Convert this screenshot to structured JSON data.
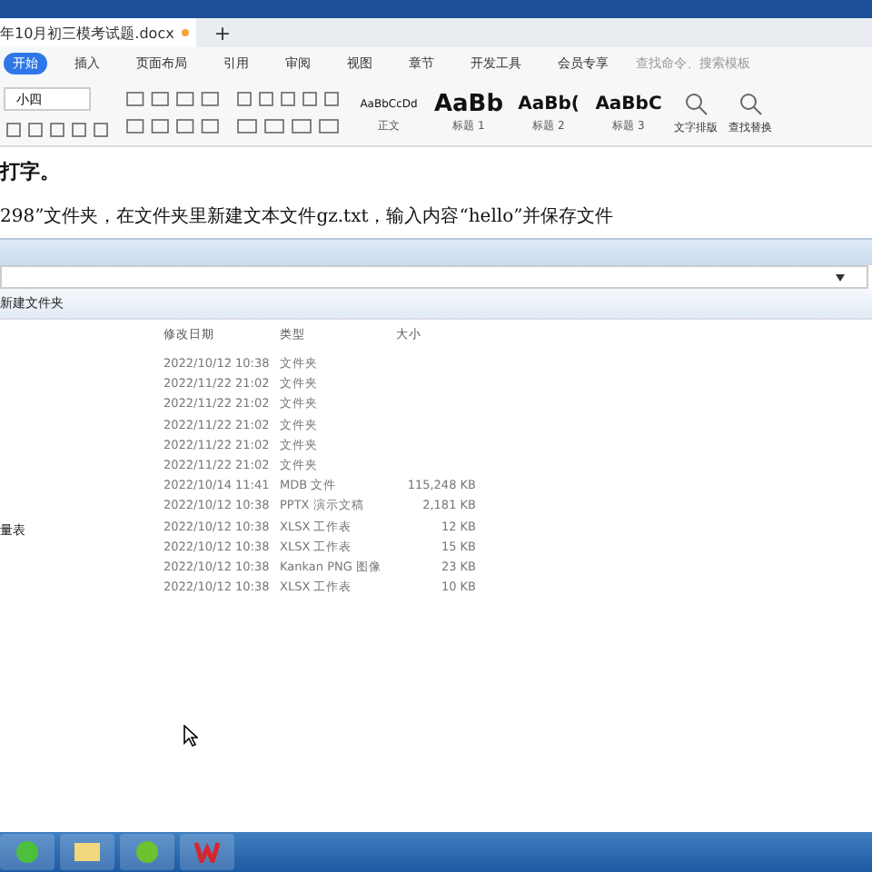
{
  "doc_tab": {
    "title": "年10月初三模考试题.docx",
    "add": "+"
  },
  "menu": {
    "items": [
      {
        "label": "开始",
        "selected": true
      },
      {
        "label": "插入",
        "selected": false
      },
      {
        "label": "页面布局",
        "selected": false
      },
      {
        "label": "引用",
        "selected": false
      },
      {
        "label": "审阅",
        "selected": false
      },
      {
        "label": "视图",
        "selected": false
      },
      {
        "label": "章节",
        "selected": false
      },
      {
        "label": "开发工具",
        "selected": false
      },
      {
        "label": "会员专享",
        "selected": false
      }
    ],
    "search_placeholder": "查找命令、搜索模板"
  },
  "toolbar": {
    "font_size": "小四",
    "styles": [
      {
        "sample": "AaBbCcDd",
        "name": "正文",
        "kind": "small"
      },
      {
        "sample": "AaBb",
        "name": "标题 1",
        "kind": "big"
      },
      {
        "sample": "AaBb(",
        "name": "标题 2",
        "kind": "mid"
      },
      {
        "sample": "AaBbC",
        "name": "标题 3",
        "kind": "mid"
      }
    ],
    "big_buttons": [
      "文字排版",
      "查找替换"
    ]
  },
  "document": {
    "lines": [
      "打字。",
      "298”文件夹，在文件夹里新建文本文件gz.txt，输入内容“hello”并保存文件"
    ]
  },
  "explorer": {
    "new_folder": "新建文件夹",
    "nav_item": "量表",
    "columns": [
      "修改日期",
      "类型",
      "大小"
    ],
    "rows": [
      [
        "2022/10/12 10:38",
        "文件夹",
        ""
      ],
      [
        "2022/11/22 21:02",
        "文件夹",
        ""
      ],
      [
        "2022/11/22 21:02",
        "文件夹",
        ""
      ],
      [
        "2022/11/22 21:02",
        "文件夹",
        ""
      ],
      [
        "2022/11/22 21:02",
        "文件夹",
        ""
      ],
      [
        "2022/11/22 21:02",
        "文件夹",
        ""
      ],
      [
        "2022/10/14 11:41",
        "MDB 文件",
        "115,248 KB"
      ],
      [
        "2022/10/12 10:38",
        "PPTX 演示文稿",
        "2,181 KB"
      ],
      [
        "2022/10/12 10:38",
        "XLSX 工作表",
        "12 KB"
      ],
      [
        "2022/10/12 10:38",
        "XLSX 工作表",
        "15 KB"
      ],
      [
        "2022/10/12 10:38",
        "Kankan PNG 图像",
        "23 KB"
      ],
      [
        "2022/10/12 10:38",
        "XLSX 工作表",
        "10 KB"
      ]
    ]
  }
}
